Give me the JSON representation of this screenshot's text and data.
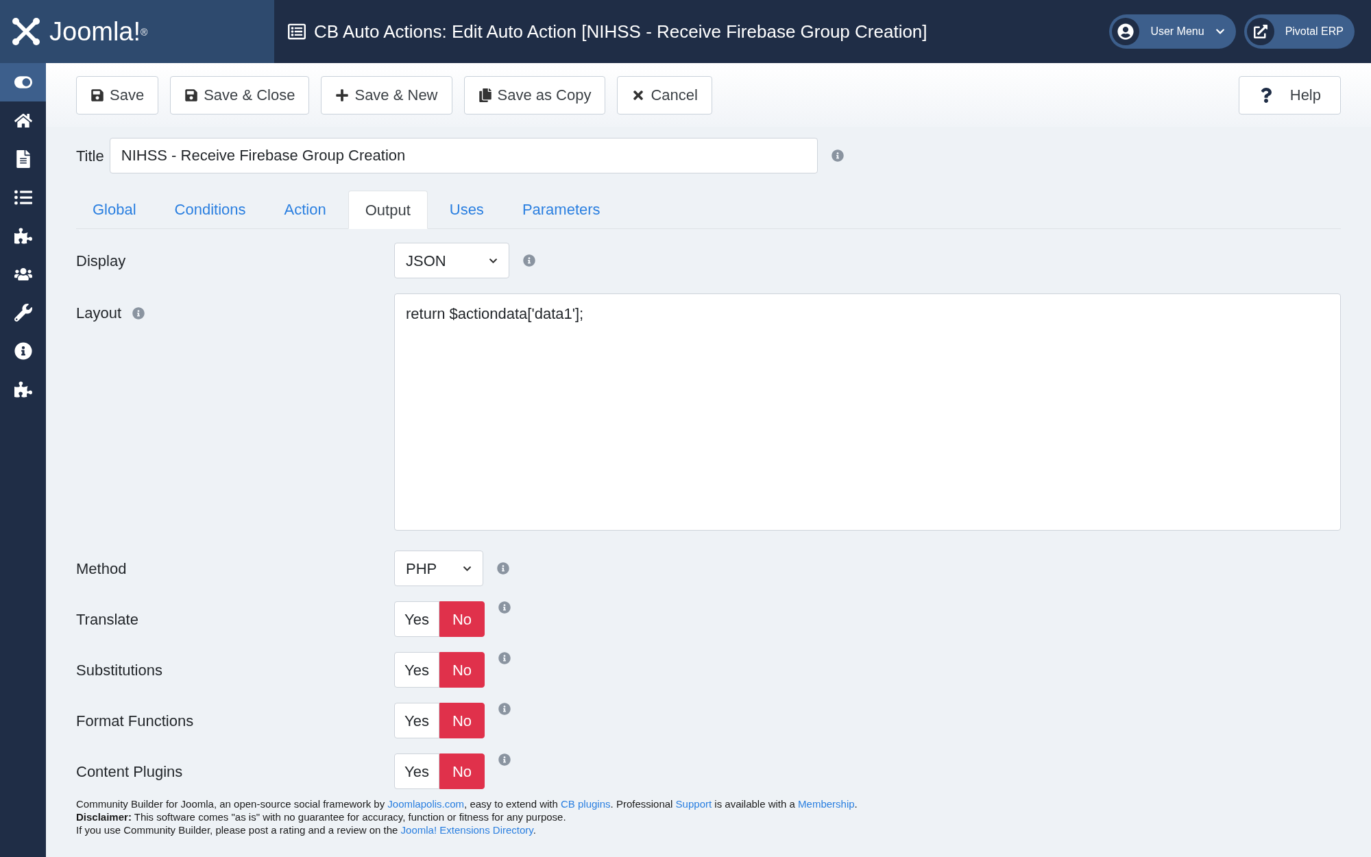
{
  "header": {
    "logo": "Joomla!$^{®}$",
    "title": "CB Auto Actions: Edit Auto Action [NIHSS - Receive Firebase Group Creation]",
    "user_menu": "User Menu",
    "site_link": "Pivotal ERP"
  },
  "sidebar": {
    "items": [
      {
        "selected": true
      },
      {
        "selected": false
      },
      {
        "selected": false
      },
      {
        "selected": false
      },
      {
        "selected": false
      },
      {
        "selected": false
      },
      {
        "selected": false
      },
      {
        "selected": false
      },
      {
        "selected": false
      }
    ]
  },
  "toolbar": {
    "buttons": [
      "Save",
      "Save & Close",
      "Save & New",
      "Save as Copy",
      "Cancel"
    ],
    "help": "Help"
  },
  "title_field": {
    "label": "Title",
    "value": "NIHSS - Receive Firebase Group Creation"
  },
  "tabs": [
    {
      "label": "Global",
      "selected": false
    },
    {
      "label": "Conditions",
      "selected": false
    },
    {
      "label": "Action",
      "selected": false
    },
    {
      "label": "Output",
      "selected": true
    },
    {
      "label": "Uses",
      "selected": false
    },
    {
      "label": "Parameters",
      "selected": false
    }
  ],
  "fields": [
    {
      "kind": "select",
      "label": "Display",
      "value": "JSON"
    },
    {
      "kind": "textarea",
      "label": "Layout",
      "value": "return $actiondata['data1'];"
    },
    {
      "kind": "select",
      "label": "Method",
      "value": "PHP"
    },
    {
      "kind": "toggle",
      "label": "Translate",
      "options": [
        {
          "label": "Yes",
          "selected": false
        },
        {
          "label": "No",
          "selected": true
        }
      ]
    },
    {
      "kind": "toggle",
      "label": "Substitutions",
      "options": [
        {
          "label": "Yes",
          "selected": false
        },
        {
          "label": "No",
          "selected": true
        }
      ]
    },
    {
      "kind": "toggle",
      "label": "Format Functions",
      "options": [
        {
          "label": "Yes",
          "selected": false
        },
        {
          "label": "No",
          "selected": true
        }
      ]
    },
    {
      "kind": "toggle",
      "label": "Content Plugins",
      "options": [
        {
          "label": "Yes",
          "selected": false
        },
        {
          "label": "No",
          "selected": true
        }
      ]
    }
  ],
  "footer": [
    [
      {
        "text": "Community Builder for Joomla, an open-source social framework by "
      },
      {
        "text": "Joomlapolis.com",
        "link": true
      },
      {
        "text": ", easy to extend with "
      },
      {
        "text": "CB plugins",
        "link": true
      },
      {
        "text": ". Professional "
      },
      {
        "text": "Support",
        "link": true
      },
      {
        "text": " is available with a "
      },
      {
        "text": "Membership",
        "link": true
      },
      {
        "text": "."
      }
    ],
    [
      {
        "text": "**Disclaimer:** This software comes \"as is\" with no guarantee for accuracy, function or fitness for any purpose."
      }
    ],
    [
      {
        "text": "If you use Community Builder, please post a rating and a review on the "
      },
      {
        "text": "Joomla! Extensions Directory",
        "link": true
      },
      {
        "text": "."
      }
    ]
  ]
}
